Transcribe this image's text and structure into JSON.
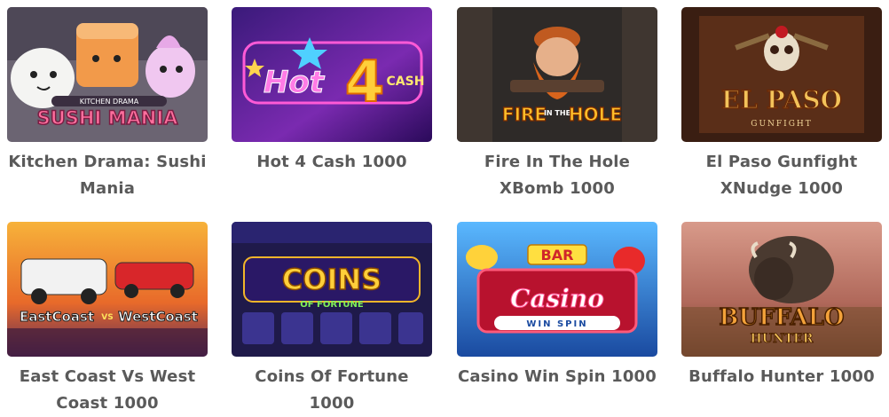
{
  "games": [
    {
      "title": "Kitchen Drama: Sushi Mania",
      "logo_top": "KITCHEN DRAMA",
      "logo_main": "SUSHI MANIA"
    },
    {
      "title": "Hot 4 Cash 1000",
      "logo_main": "Hot",
      "logo_num": "4",
      "logo_sub": "CASH"
    },
    {
      "title": "Fire In The Hole XBomb 1000",
      "logo_main": "FIRE",
      "logo_mid": "IN THE",
      "logo_end": "HOLE"
    },
    {
      "title": "El Paso Gunfight XNudge 1000",
      "logo_main": "EL PASO",
      "logo_sub": "GUNFIGHT"
    },
    {
      "title": "East Coast Vs West Coast 1000",
      "logo_main": "EastCoast",
      "logo_vs": "VS",
      "logo_end": "WestCoast"
    },
    {
      "title": "Coins Of Fortune 1000",
      "logo_main": "COINS",
      "logo_sub": "OF FORTUNE"
    },
    {
      "title": "Casino Win Spin 1000",
      "logo_top": "BAR",
      "logo_main": "Casino",
      "logo_sub": "WIN SPIN"
    },
    {
      "title": "Buffalo Hunter 1000",
      "logo_main": "BUFFALO",
      "logo_sub": "HUNTER"
    }
  ]
}
